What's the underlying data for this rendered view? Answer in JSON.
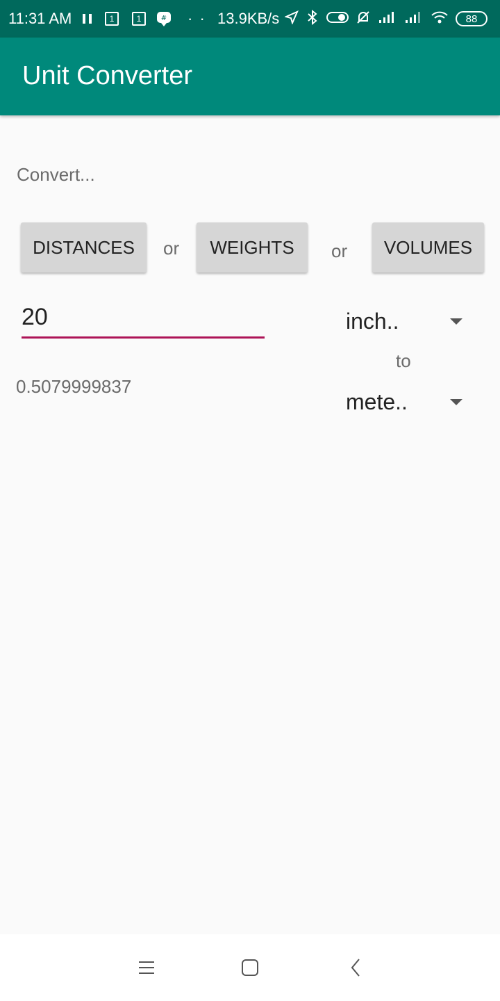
{
  "status_bar": {
    "time": "11:31 AM",
    "sim1_label": "1",
    "sim2_label": "1",
    "dots": "· ·",
    "net_speed": "13.9KB/s",
    "battery": "88",
    "icons": [
      "pause-icon",
      "sim-icon",
      "sim-icon",
      "chat-icon",
      "location-icon",
      "bluetooth-icon",
      "toggle-icon",
      "alarm-off-icon",
      "signal-icon",
      "signal-icon",
      "wifi-icon",
      "battery-icon"
    ]
  },
  "app_bar": {
    "title": "Unit Converter"
  },
  "main": {
    "convert_label": "Convert...",
    "buttons": {
      "distances": "DISTANCES",
      "weights": "WEIGHTS",
      "volumes": "VOLUMES"
    },
    "separator_1": "or",
    "separator_2": "or",
    "input": {
      "value": "20"
    },
    "from_unit": "inch..",
    "to_label": "to",
    "to_unit": "mete..",
    "result": "0.5079999837"
  },
  "nav_bar": {
    "icons": [
      "menu-icon",
      "home-icon",
      "back-icon"
    ]
  },
  "colors": {
    "status_bar": "#00695c",
    "app_bar": "#00897b",
    "accent": "#ad1457",
    "background": "#fafafa",
    "button": "#d6d6d6"
  }
}
